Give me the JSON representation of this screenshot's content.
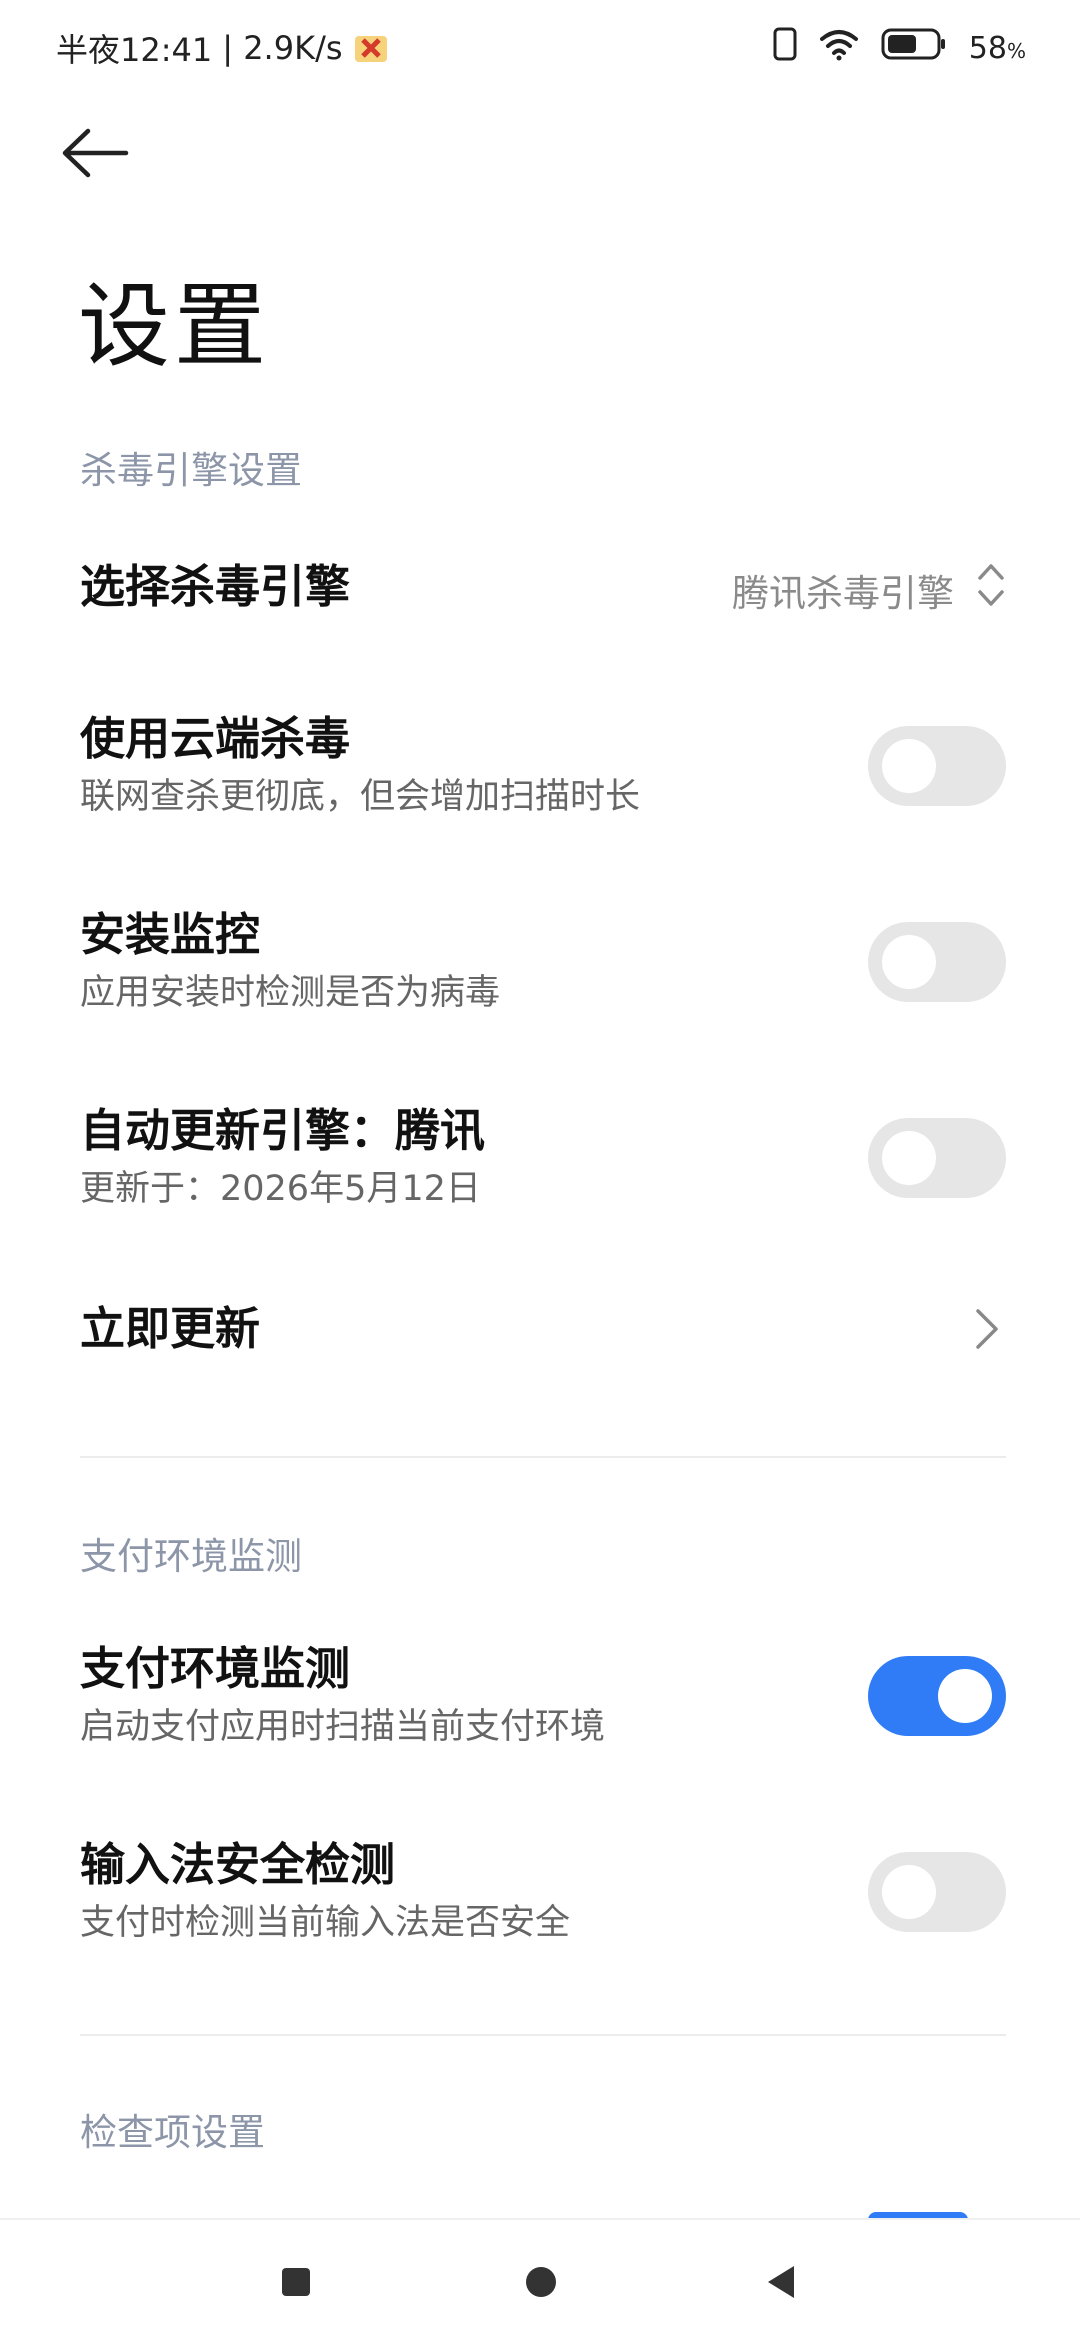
{
  "status_bar": {
    "time": "半夜12:41",
    "speed": "| 2.9K/s",
    "battery_percent": "58",
    "battery_unit": "%"
  },
  "header": {
    "title": "设置"
  },
  "sections": {
    "engine": {
      "header": "杀毒引擎设置",
      "select_engine": {
        "title": "选择杀毒引擎",
        "value": "腾讯杀毒引擎"
      },
      "cloud_scan": {
        "title": "使用云端杀毒",
        "subtitle": "联网查杀更彻底，但会增加扫描时长",
        "enabled": false
      },
      "install_monitor": {
        "title": "安装监控",
        "subtitle": "应用安装时检测是否为病毒",
        "enabled": false
      },
      "auto_update": {
        "title": "自动更新引擎：腾讯",
        "subtitle": "更新于：2026年5月12日",
        "enabled": false
      },
      "update_now": {
        "title": "立即更新"
      }
    },
    "payment": {
      "header": "支付环境监测",
      "payment_monitor": {
        "title": "支付环境监测",
        "subtitle": "启动支付应用时扫描当前支付环境",
        "enabled": true
      },
      "ime_check": {
        "title": "输入法安全检测",
        "subtitle": "支付时检测当前输入法是否安全",
        "enabled": false
      }
    },
    "checks": {
      "header": "检查项设置"
    }
  },
  "icons": {
    "back": "arrow-left-icon",
    "sort": "up-down-chevron-icon",
    "chevron": "chevron-right-icon",
    "sim": "sim-icon",
    "wifi": "wifi-icon",
    "battery": "battery-icon"
  },
  "colors": {
    "accent": "#2f7cf6",
    "section_header": "#8c96a8",
    "toggle_off": "#e6e6e6"
  }
}
